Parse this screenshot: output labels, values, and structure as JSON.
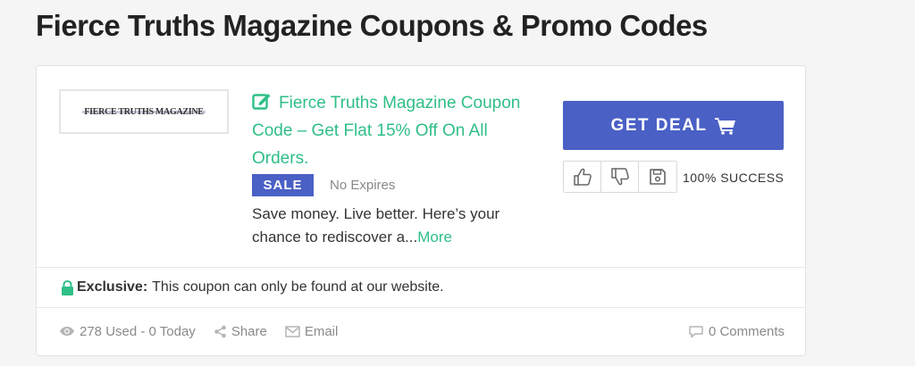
{
  "page": {
    "title": "Fierce Truths Magazine Coupons & Promo Codes"
  },
  "coupon": {
    "logo_text": "FIERCE TRUTHS MAGAZINE",
    "title": "Fierce Truths Magazine Coupon Code – Get Flat 15% Off On All Orders.",
    "badge": "SALE",
    "expiry": "No Expires",
    "description": "Save money. Live better. Here’s your chance to rediscover a...",
    "more_label": "More",
    "deal_button": "GET DEAL",
    "success_rate": "100% SUCCESS",
    "exclusive_label": "Exclusive:",
    "exclusive_text": "This coupon can only be found at our website."
  },
  "footer": {
    "used": "278 Used - 0 Today",
    "share": "Share",
    "email": "Email",
    "comments": "0 Comments"
  },
  "colors": {
    "accent_green": "#2fbf87",
    "brand_blue": "#4a60c5",
    "lock_green": "#2fbf87"
  },
  "icons": [
    "edit-icon",
    "cart-icon",
    "thumbs-up-icon",
    "thumbs-down-icon",
    "save-icon",
    "lock-icon",
    "eye-icon",
    "share-icon",
    "email-icon",
    "comments-icon"
  ]
}
